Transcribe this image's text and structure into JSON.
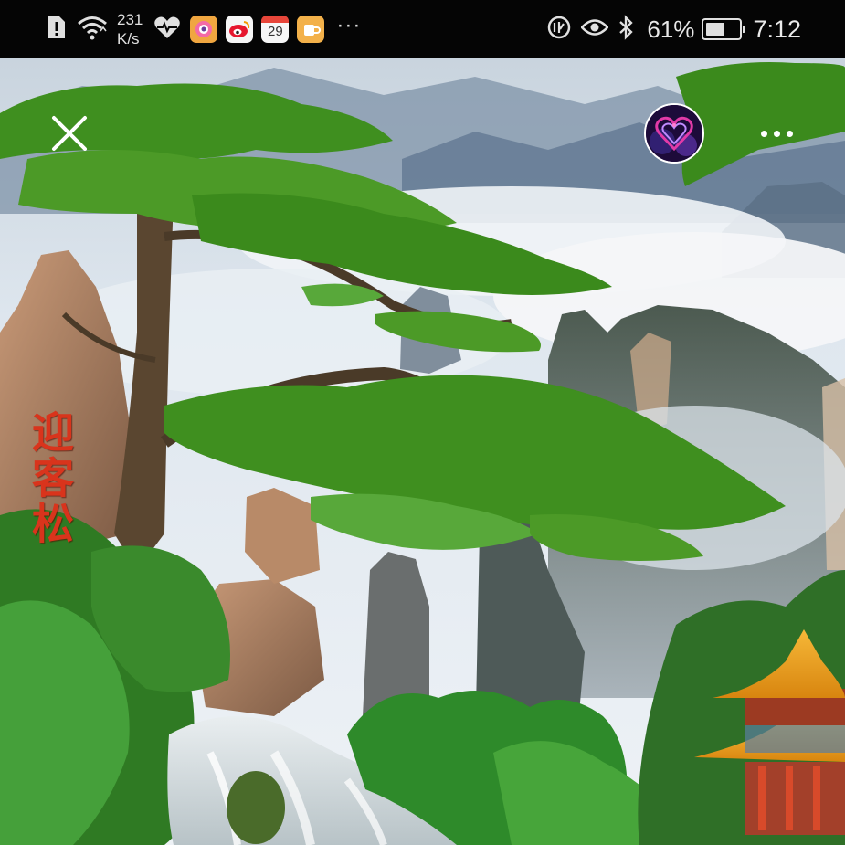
{
  "status_bar": {
    "net_speed_value": "231",
    "net_speed_unit": "K/s",
    "calendar_day": "29",
    "battery_percent_text": "61%",
    "battery_level": 0.61,
    "time": "7:12",
    "more_label": "···"
  },
  "content": {
    "carved_text": "迎客松",
    "avatar_icon": "heart-avatar"
  },
  "colors": {
    "status_bar_bg": "#050505",
    "carved_text": "#d9341c",
    "pine_green": "#3f8f1f",
    "pagoda_roof": "#f0a320",
    "sky": "#dfe8f0"
  }
}
